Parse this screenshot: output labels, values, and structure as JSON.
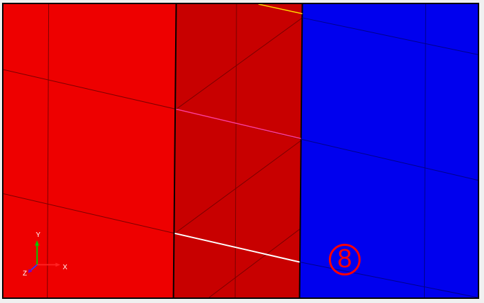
{
  "viewport": {
    "faces": {
      "left_color": "#ee0000",
      "middle_color": "#c80000",
      "right_color": "#0000ee"
    },
    "edge_colors": {
      "highlight_magenta": "#ff3d9a",
      "highlight_white": "#ffffff",
      "highlight_yellow": "#ffd800"
    },
    "marker_label": "8",
    "axis_triad": {
      "x_label": "X",
      "y_label": "Y",
      "z_label": "Z"
    }
  }
}
